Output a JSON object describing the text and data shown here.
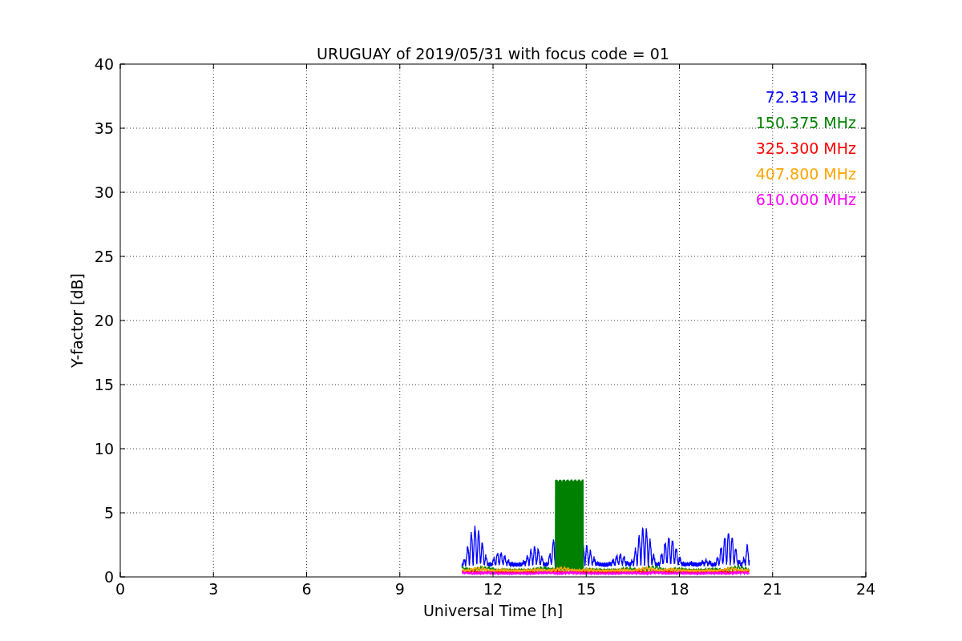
{
  "plot": {
    "title": "URUGUAY of 2019/05/31 with focus code = 01",
    "xlabel": "Universal Time [h]",
    "ylabel": "Y-factor [dB]",
    "xticks": [
      "0",
      "3",
      "6",
      "9",
      "12",
      "15",
      "18",
      "21",
      "24"
    ],
    "yticks": [
      "40",
      "35",
      "30",
      "25",
      "20",
      "15",
      "10",
      "5",
      "0"
    ],
    "legend": [
      {
        "label": "72.313 MHz",
        "color": "#0000ff"
      },
      {
        "label": "150.375 MHz",
        "color": "#008000"
      },
      {
        "label": "325.300 MHz",
        "color": "#ff0000"
      },
      {
        "label": "407.800 MHz",
        "color": "#ffa500"
      },
      {
        "label": "610.000 MHz",
        "color": "#ff00ff"
      }
    ]
  }
}
